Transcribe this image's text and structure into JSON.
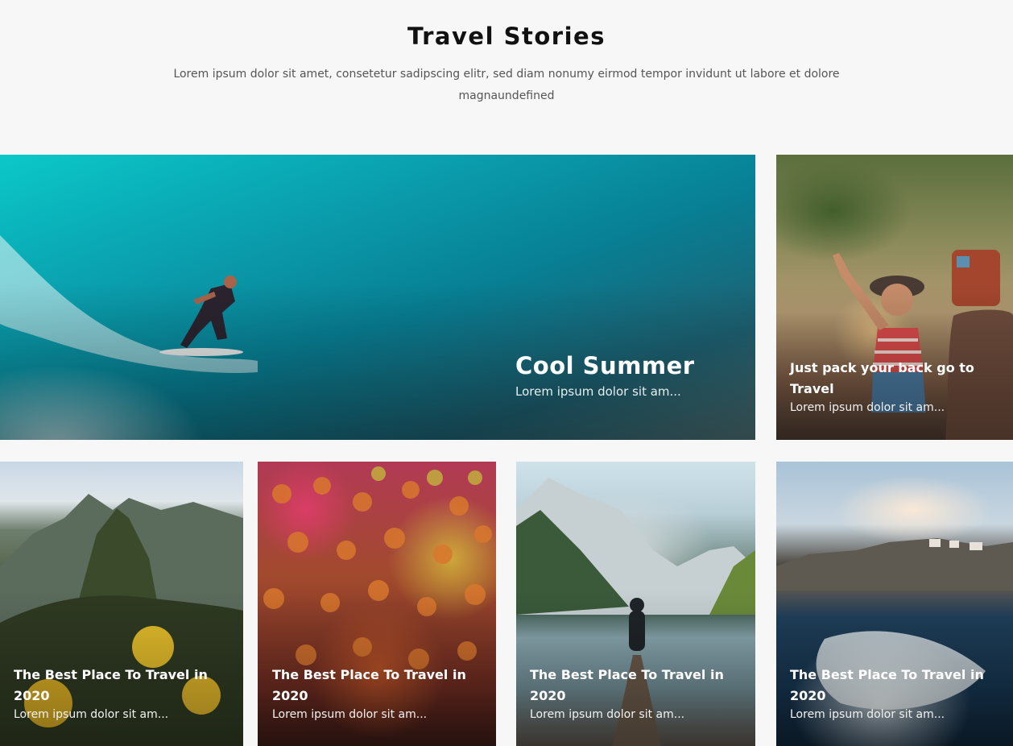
{
  "header": {
    "title": "Travel Stories",
    "subtitle": "Lorem ipsum dolor sit amet, consetetur sadipscing elitr, sed diam nonumy eirmod tempor invidunt ut labore et dolore magnaundefined"
  },
  "stories": [
    {
      "title": "Cool Summer",
      "excerpt": "Lorem ipsum dolor sit am...",
      "image_icon": "surfer-wave-image"
    },
    {
      "title": "Just pack your back go to Travel",
      "excerpt": "Lorem ipsum dolor sit am...",
      "image_icon": "woman-car-image"
    },
    {
      "title": "The Best Place To Travel in 2020",
      "excerpt": "Lorem ipsum dolor sit am...",
      "image_icon": "mountain-ruins-image"
    },
    {
      "title": "The Best Place To Travel in 2020",
      "excerpt": "Lorem ipsum dolor sit am...",
      "image_icon": "festival-crowd-image"
    },
    {
      "title": "The Best Place To Travel in 2020",
      "excerpt": "Lorem ipsum dolor sit am...",
      "image_icon": "lake-dock-image"
    },
    {
      "title": "The Best Place To Travel in 2020",
      "excerpt": "Lorem ipsum dolor sit am...",
      "image_icon": "coast-waves-image"
    }
  ]
}
